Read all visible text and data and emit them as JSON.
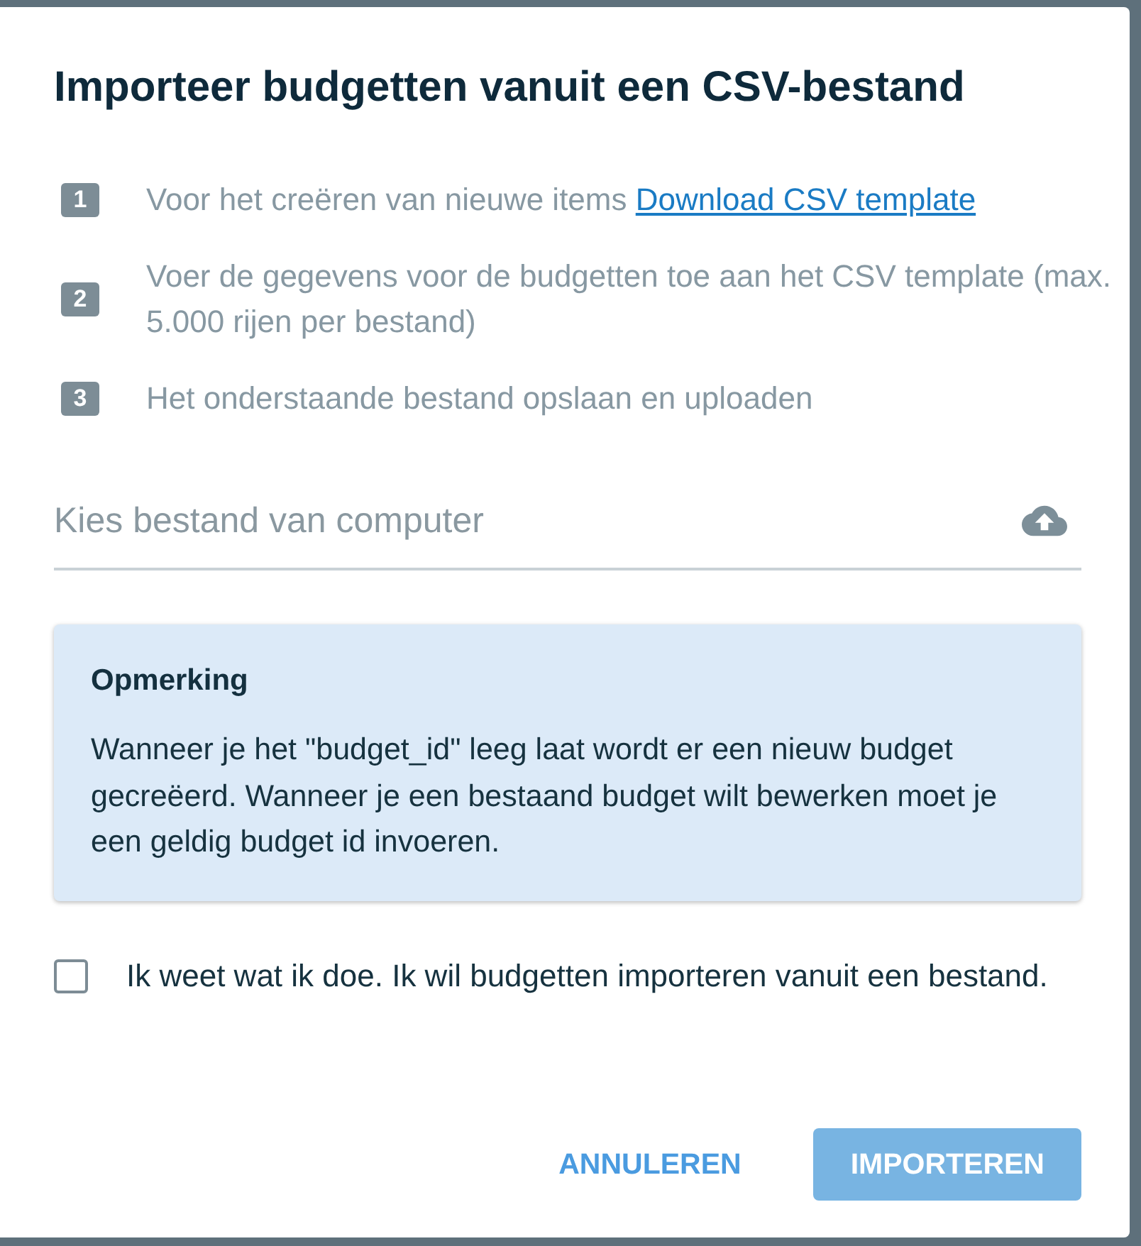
{
  "dialog": {
    "title": "Importeer budgetten vanuit een CSV-bestand",
    "steps": [
      {
        "number": "1",
        "text": "Voor het creëren van nieuwe items",
        "link": "Download CSV template"
      },
      {
        "number": "2",
        "text": "Voer de gegevens voor de budgetten toe aan het CSV template (max. 5.000 rijen per bestand)"
      },
      {
        "number": "3",
        "text": "Het onderstaande bestand opslaan en uploaden"
      }
    ],
    "file_field": {
      "placeholder": "Kies bestand van computer"
    },
    "note": {
      "title": "Opmerking",
      "text": "Wanneer je het \"budget_id\" leeg laat wordt er een nieuw budget gecreëerd. Wanneer je een bestaand budget wilt bewerken moet je een geldig budget id invoeren."
    },
    "confirm": {
      "label": "Ik weet wat ik doe. Ik wil budgetten importeren vanuit een bestand.",
      "checked": false
    },
    "buttons": [
      {
        "label": "ANNULEREN",
        "kind": "text",
        "disabled": false
      },
      {
        "label": "IMPORTEREN",
        "kind": "filled",
        "disabled": true
      }
    ]
  }
}
